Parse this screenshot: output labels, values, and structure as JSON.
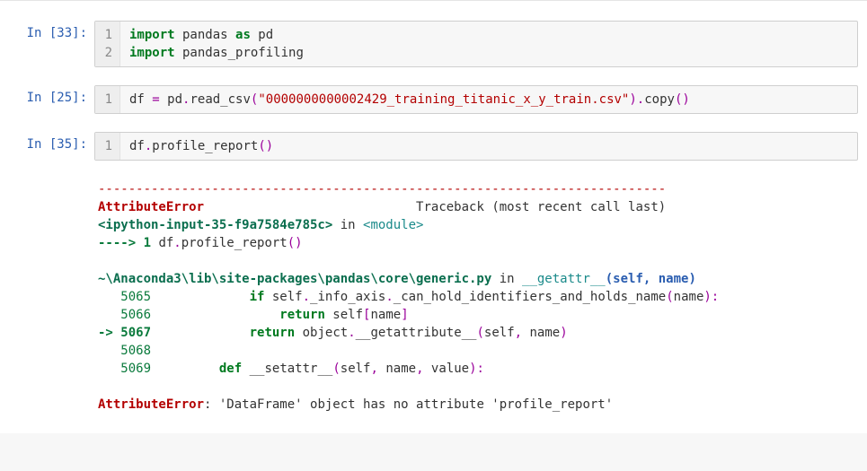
{
  "cells": [
    {
      "prompt": "In [33]:",
      "gutter": [
        "1",
        "2"
      ],
      "code_tokens": [
        [
          [
            "kw",
            "import"
          ],
          [
            "name",
            " pandas "
          ],
          [
            "kw",
            "as"
          ],
          [
            "name",
            " pd"
          ]
        ],
        [
          [
            "kw",
            "import"
          ],
          [
            "name",
            " pandas_profiling"
          ]
        ]
      ]
    },
    {
      "prompt": "In [25]:",
      "gutter": [
        "1"
      ],
      "code_tokens": [
        [
          [
            "name",
            "df "
          ],
          [
            "op",
            "="
          ],
          [
            "name",
            " pd"
          ],
          [
            "op",
            "."
          ],
          [
            "name",
            "read_csv"
          ],
          [
            "op",
            "("
          ],
          [
            "str",
            "\"0000000000002429_training_titanic_x_y_train.csv\""
          ],
          [
            "op",
            ")."
          ],
          [
            "name",
            "copy"
          ],
          [
            "op",
            "()"
          ]
        ]
      ]
    },
    {
      "prompt": "In [35]:",
      "gutter": [
        "1"
      ],
      "code_tokens": [
        [
          [
            "name",
            "df"
          ],
          [
            "op",
            "."
          ],
          [
            "name",
            "profile_report"
          ],
          [
            "op",
            "()"
          ]
        ]
      ]
    }
  ],
  "traceback": {
    "dash": "---------------------------------------------------------------------------",
    "err_name": "AttributeError",
    "tb_label": "Traceback (most recent call last)",
    "tb_label_pad": "                            ",
    "frame0_loc": "<ipython-input-35-f9a7584e785c>",
    "frame0_in": " in ",
    "frame0_mod": "<module>",
    "arrow1": "----> 1 ",
    "frame0_code_pre": "df",
    "frame0_code_op1": ".",
    "frame0_code_mid": "profile_report",
    "frame0_code_op2": "()",
    "frame1_path": "~\\Anaconda3\\lib\\site-packages\\pandas\\core\\generic.py",
    "frame1_in": " in ",
    "frame1_fn": "__getattr__",
    "frame1_sig_open": "(self, name)",
    "l5065_num": "   5065 ",
    "l5065_code_pre": "            ",
    "l5065_if": "if",
    "l5065_rest1": " self",
    "l5065_op1": ".",
    "l5065_rest2": "_info_axis",
    "l5065_op2": ".",
    "l5065_rest3": "_can_hold_identifiers_and_holds_name",
    "l5065_op3": "(",
    "l5065_rest4": "name",
    "l5065_op4": "):",
    "l5066_num": "   5066 ",
    "l5066_pad": "                ",
    "l5066_ret": "return",
    "l5066_rest1": " self",
    "l5066_op1": "[",
    "l5066_rest2": "name",
    "l5066_op2": "]",
    "l5067_arrow": "-> 5067 ",
    "l5067_pad": "            ",
    "l5067_ret": "return",
    "l5067_rest1": " object",
    "l5067_op1": ".",
    "l5067_rest2": "__getattribute__",
    "l5067_op2": "(",
    "l5067_rest3": "self",
    "l5067_op3": ", ",
    "l5067_rest4": "name",
    "l5067_op4": ")",
    "l5068_num": "   5068 ",
    "l5069_num": "   5069 ",
    "l5069_pad": "        ",
    "l5069_def": "def",
    "l5069_fn": " __setattr__",
    "l5069_op1": "(",
    "l5069_a1": "self",
    "l5069_c1": ", ",
    "l5069_a2": "name",
    "l5069_c2": ", ",
    "l5069_a3": "value",
    "l5069_op2": "):",
    "final_err": "AttributeError",
    "final_sep": ": ",
    "final_msg": "'DataFrame' object has no attribute 'profile_report'"
  }
}
